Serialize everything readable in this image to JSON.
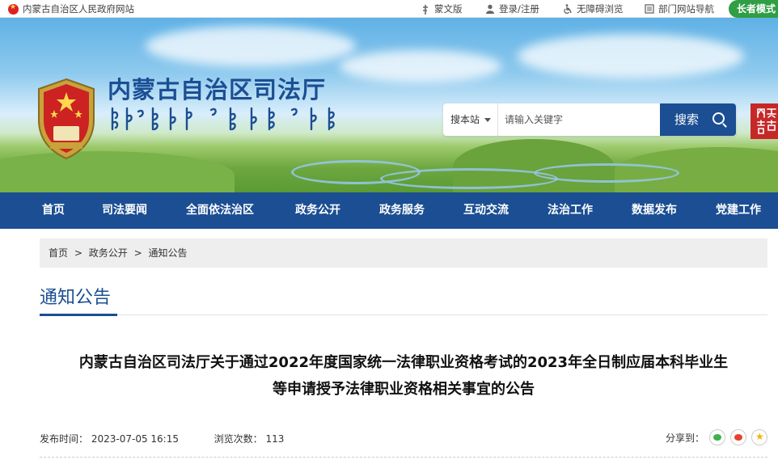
{
  "topbar": {
    "site_name": "内蒙古自治区人民政府网站",
    "links": [
      {
        "label": "蒙文版",
        "icon": "mongolian-script-icon"
      },
      {
        "label": "登录/注册",
        "icon": "user-icon"
      },
      {
        "label": "无障碍浏览",
        "icon": "accessibility-icon"
      },
      {
        "label": "部门网站导航",
        "icon": "list-icon"
      }
    ],
    "elder_mode": "长者模式"
  },
  "header": {
    "title": "内蒙古自治区司法厅",
    "title_mongolian": "ᠥᠪᠦᠷ ᠮᠤᠩᠭᠤᠯ ᠤᠨ ᠥᠪᠡᠷᠲᠡᠭᠡᠨ ᠵᠠᠰᠠᠬᠤ ᠣᠷᠣᠨ ᠤ ᠱᠢᠭᠦᠨ ᠲᠤᠰᠬᠠᠯ ᠤᠨ ᠲᠢᠩᠬᠢᠮ",
    "search": {
      "scope": "搜本站",
      "placeholder": "请输入关键字",
      "button": "搜索"
    },
    "seal_text": "内蒙古"
  },
  "nav": {
    "items": [
      "首页",
      "司法要闻",
      "全面依法治区",
      "政务公开",
      "政务服务",
      "互动交流",
      "法治工作",
      "数据发布",
      "党建工作"
    ]
  },
  "breadcrumb": [
    "首页",
    "政务公开",
    "通知公告"
  ],
  "breadcrumb_sep": ">",
  "section_title": "通知公告",
  "article": {
    "title_line1": "内蒙古自治区司法厅关于通过2022年度国家统一法律职业资格考试的2023年全日制应届本科毕业生",
    "title_line2": "等申请授予法律职业资格相关事宜的公告",
    "publish_label": "发布时间：",
    "publish_time": "2023-07-05 16:15",
    "views_label": "浏览次数：",
    "views": "113",
    "share_label": "分享到："
  },
  "colors": {
    "brand_blue": "#1b4e93",
    "elder_green": "#2f9e44",
    "breadcrumb_bg": "#eeeeee"
  }
}
